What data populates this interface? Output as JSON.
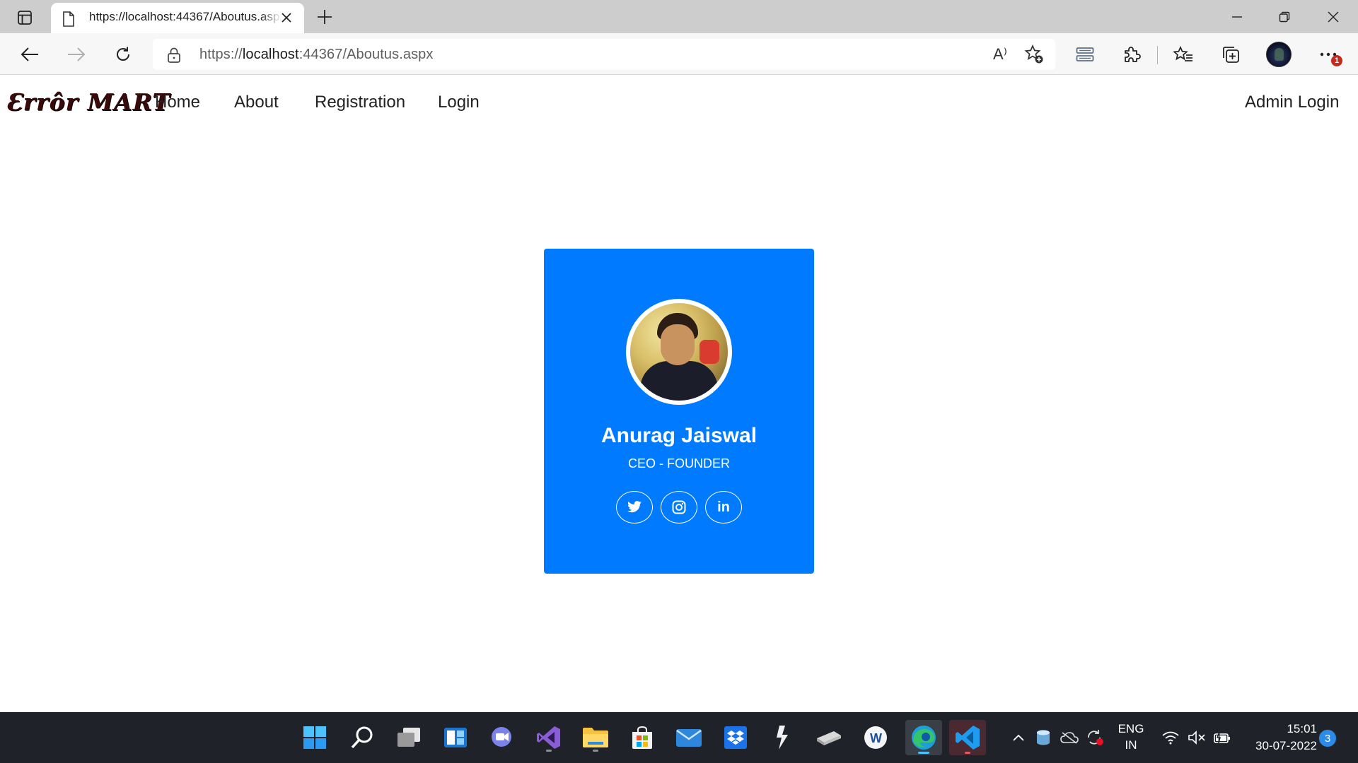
{
  "browser": {
    "tab_title": "https://localhost:44367/Aboutus.aspx",
    "url_scheme": "https://",
    "url_host": "localhost",
    "url_rest": ":44367/Aboutus.aspx",
    "read_aloud_label": "A⁾",
    "notification_count": "1"
  },
  "site": {
    "brand": "Ɛrrôr MART",
    "nav": {
      "home": "Home",
      "about": "About",
      "registration": "Registration",
      "login": "Login",
      "admin_login": "Admin Login"
    },
    "card": {
      "name": "Anurag Jaiswal",
      "role": "CEO - FOUNDER",
      "social": [
        "twitter-icon",
        "instagram-icon",
        "linkedin-icon"
      ],
      "linkedin_label": "in",
      "background_color": "#007bff"
    }
  },
  "taskbar": {
    "language_line1": "ENG",
    "language_line2": "IN",
    "time": "15:01",
    "date": "30-07-2022",
    "notifications": "3"
  }
}
